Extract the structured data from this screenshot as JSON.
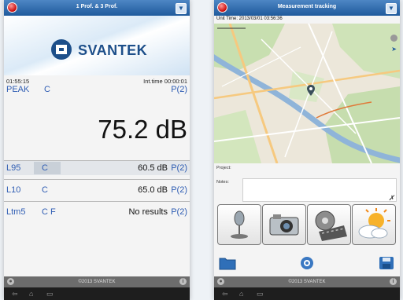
{
  "left_screen": {
    "title": "1 Prof. & 3 Prof.",
    "brand": "SVANTEK",
    "elapsed_time": "01:55:15",
    "int_time": "Int.time 00:00:01",
    "peak_row": {
      "label": "PEAK",
      "weighting": "C",
      "profile": "P(2)"
    },
    "main_value": "75.2 dB",
    "results": [
      {
        "label": "L95",
        "weighting": "C",
        "value": "60.5 dB",
        "profile": "P(2)"
      },
      {
        "label": "L10",
        "weighting": "C",
        "value": "65.0 dB",
        "profile": "P(2)"
      },
      {
        "label": "Ltm5",
        "weighting": "C F",
        "value": "No results",
        "profile": "P(2)"
      }
    ],
    "footer": "©2013 SVANTEK"
  },
  "right_screen": {
    "title": "Measurement tracking",
    "unit_time": "Unit Time: 2013/03/01 03:56:36",
    "project_label": "Project:",
    "notes_label": "Notes:",
    "footer": "©2013 SVANTEK"
  },
  "colors": {
    "titlebar": "#2b6bb0",
    "accent_blue": "#2f5db3",
    "brand": "#1d4f8a"
  },
  "icons": [
    "app-logo-icon",
    "menu-icon",
    "info-icon",
    "microphone-icon",
    "camera-icon",
    "film-icon",
    "weather-icon",
    "folder-icon",
    "target-icon",
    "save-icon"
  ]
}
